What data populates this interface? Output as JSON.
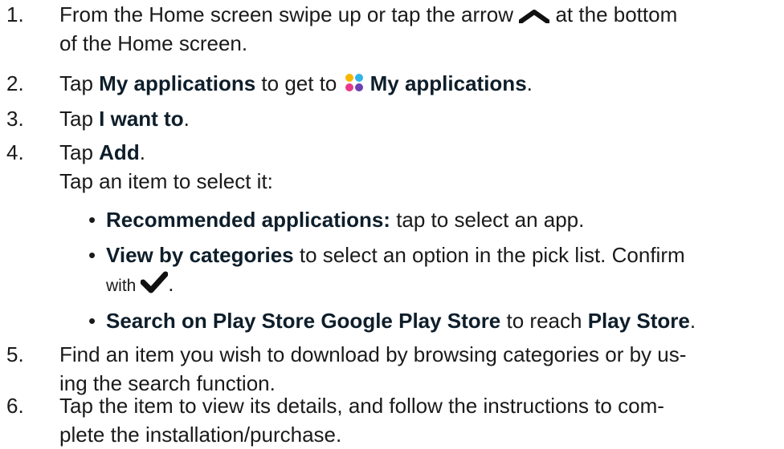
{
  "steps": [
    {
      "num": "1.",
      "line1_pre": "From the Home screen swipe up or tap the arrow ",
      "line1_post": " at the bottom",
      "line2": "of the Home screen."
    },
    {
      "num": "2.",
      "pre": "Tap ",
      "bold1": "My applications",
      "mid": " to get to ",
      "bold2": "My applications",
      "post": "."
    },
    {
      "num": "3.",
      "pre": "Tap ",
      "bold": "I want to",
      "post": "."
    },
    {
      "num": "4.",
      "pre": "Tap ",
      "bold": "Add",
      "post": ".",
      "line2": "Tap an item to select it:"
    },
    {
      "num": "5.",
      "line1": "Find an item you wish to download by browsing categories or by us-",
      "line2": "ing the search function."
    },
    {
      "num": "6.",
      "line1": "Tap the item to view its details, and follow the instructions to com-",
      "line2": "plete the installation/purchase."
    }
  ],
  "bullets": [
    {
      "dot": "•",
      "bold": "Recommended applications:",
      "post": " tap to select an app."
    },
    {
      "dot": "•",
      "bold": "View by categories",
      "post": " to select an option in the pick list. Confirm",
      "line2_pre": "with ",
      "line2_post": "."
    },
    {
      "dot": "•",
      "bold": "Search on Play Store Google Play Store",
      "mid": " to reach ",
      "bold2": "Play Store",
      "post": "."
    }
  ],
  "icons": {
    "arrow": "chevron-up-icon",
    "apps": "my-applications-icon",
    "confirm": "checkmark-icon",
    "app_colors": [
      "#f5b700",
      "#2fb4e9",
      "#e8388a",
      "#6c3fb5"
    ]
  }
}
